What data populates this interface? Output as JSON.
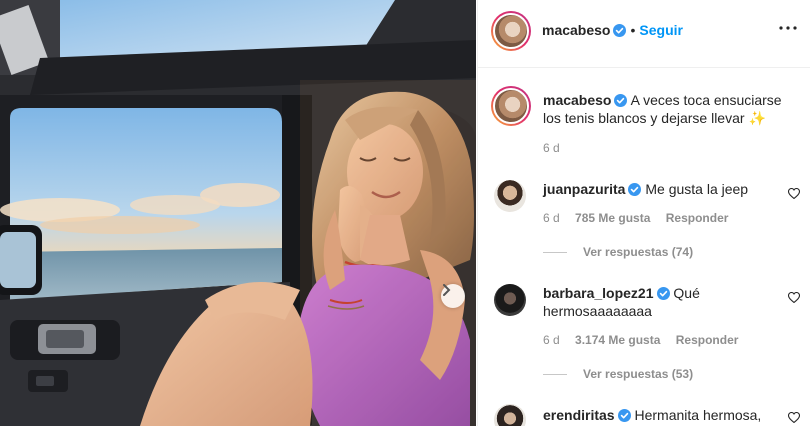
{
  "post": {
    "author": "macabeso",
    "follow_label": "Seguir",
    "separator": "•",
    "caption": "A veces toca ensuciarse los tenis blancos y dejarse llevar",
    "caption_emoji": "✨",
    "caption_age": "6 d"
  },
  "comments": [
    {
      "user": "juanpazurita",
      "text": "Me gusta la jeep",
      "age": "6 d",
      "likes": "785 Me gusta",
      "reply_label": "Responder",
      "view_replies": "Ver respuestas (74)"
    },
    {
      "user": "barbara_lopez21",
      "text": "Qué hermosaaaaaaaa",
      "age": "6 d",
      "likes": "3.174 Me gusta",
      "reply_label": "Responder",
      "view_replies": "Ver respuestas (53)"
    },
    {
      "user": "erendiritas",
      "text": "Hermanita hermosa,"
    }
  ],
  "icons": {
    "verified": "verified-badge-icon",
    "more": "more-options-icon",
    "like": "heart-icon",
    "next": "chevron-right-icon"
  },
  "colors": {
    "accent": "#0095f6",
    "verified": "#3897f0",
    "muted": "#8e8e8e",
    "dress": "#b05ac8"
  }
}
